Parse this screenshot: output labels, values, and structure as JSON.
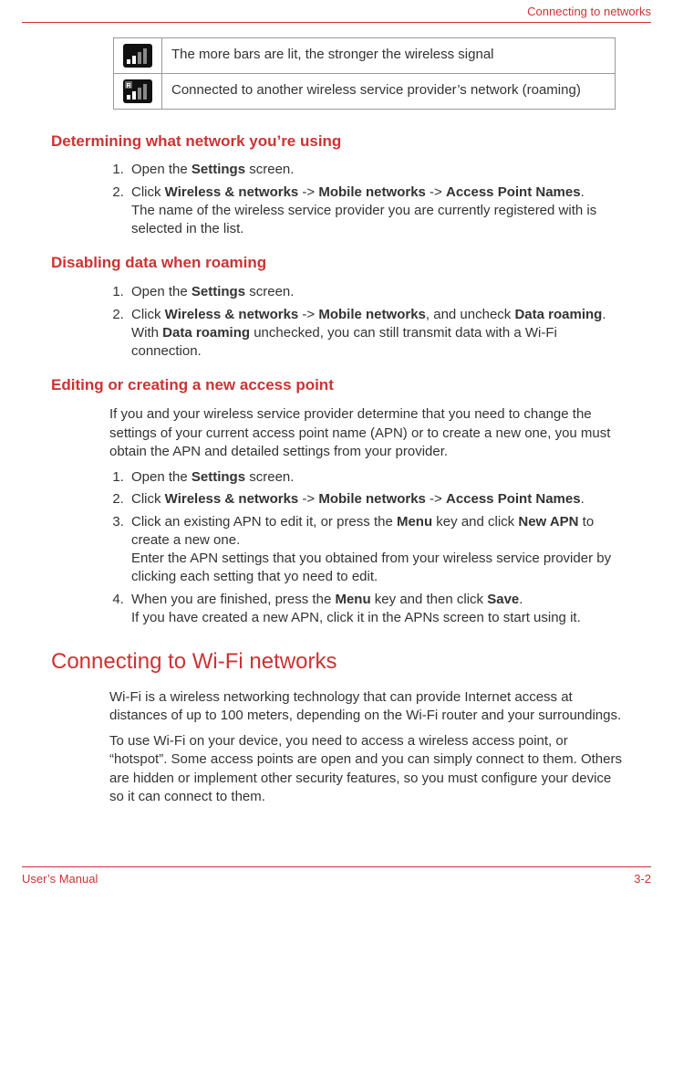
{
  "header": {
    "right_text": "Connecting to networks"
  },
  "icons": {
    "row1_desc": "The more bars are lit, the stronger the wireless signal",
    "row2_desc": "Connected to another wireless service provider’s network (roaming)"
  },
  "h_determine": "Determining what network you’re using",
  "det": {
    "s1a": "Open the ",
    "s1b": "Settings",
    "s1c": " screen.",
    "s2a": "Click ",
    "s2b": "Wireless & networks",
    "s2c": " -> ",
    "s2d": "Mobile networks",
    "s2e": " -> ",
    "s2f": "Access Point Names",
    "s2g": ".",
    "s2_tail": "The name of the wireless service provider you are currently registered with is selected in the list."
  },
  "h_disable": "Disabling data when roaming",
  "dis": {
    "s1a": "Open the ",
    "s1b": "Settings",
    "s1c": " screen.",
    "s2a": "Click ",
    "s2b": "Wireless & networks",
    "s2c": " -> ",
    "s2d": "Mobile networks",
    "s2e": ", and uncheck ",
    "s2f": "Data roaming",
    "s2g": ".",
    "s2_tail_a": "With ",
    "s2_tail_b": "Data roaming",
    "s2_tail_c": " unchecked, you can still transmit data with a Wi-Fi connection."
  },
  "h_edit": "Editing or creating a new access point",
  "edit_intro": "If you and your wireless service provider determine that you need to change the settings of your current access point name (APN) or to create a new one, you must obtain the APN and detailed settings from your provider.",
  "edit": {
    "s1a": "Open the ",
    "s1b": "Settings",
    "s1c": " screen.",
    "s2a": "Click ",
    "s2b": "Wireless & networks",
    "s2c": " -> ",
    "s2d": "Mobile networks",
    "s2e": " -> ",
    "s2f": "Access Point Names",
    "s2g": ".",
    "s3a": "Click an existing APN to edit it, or press the ",
    "s3b": "Menu",
    "s3c": " key and click ",
    "s3d": "New APN",
    "s3e": " to create a new one.",
    "s3_tail": "Enter the APN settings that you obtained from your wireless service provider by clicking each setting that yo need to edit.",
    "s4a": "When you are finished, press the ",
    "s4b": "Menu",
    "s4c": " key and then click ",
    "s4d": "Save",
    "s4e": ".",
    "s4_tail": "If you have created a new APN, click it in the APNs screen to start using it."
  },
  "h_wifi": "Connecting to Wi-Fi networks",
  "wifi_p1": "Wi-Fi is a wireless networking technology that can provide Internet access at distances of up to 100 meters, depending on the Wi-Fi router and your surroundings.",
  "wifi_p2": "To use Wi-Fi on your device, you need to access a wireless access point, or “hotspot”. Some access points are open and you can simply connect to them. Others are hidden or implement other security features, so you must configure your device so it can connect to them.",
  "footer": {
    "left": "User’s Manual",
    "right": "3-2"
  }
}
